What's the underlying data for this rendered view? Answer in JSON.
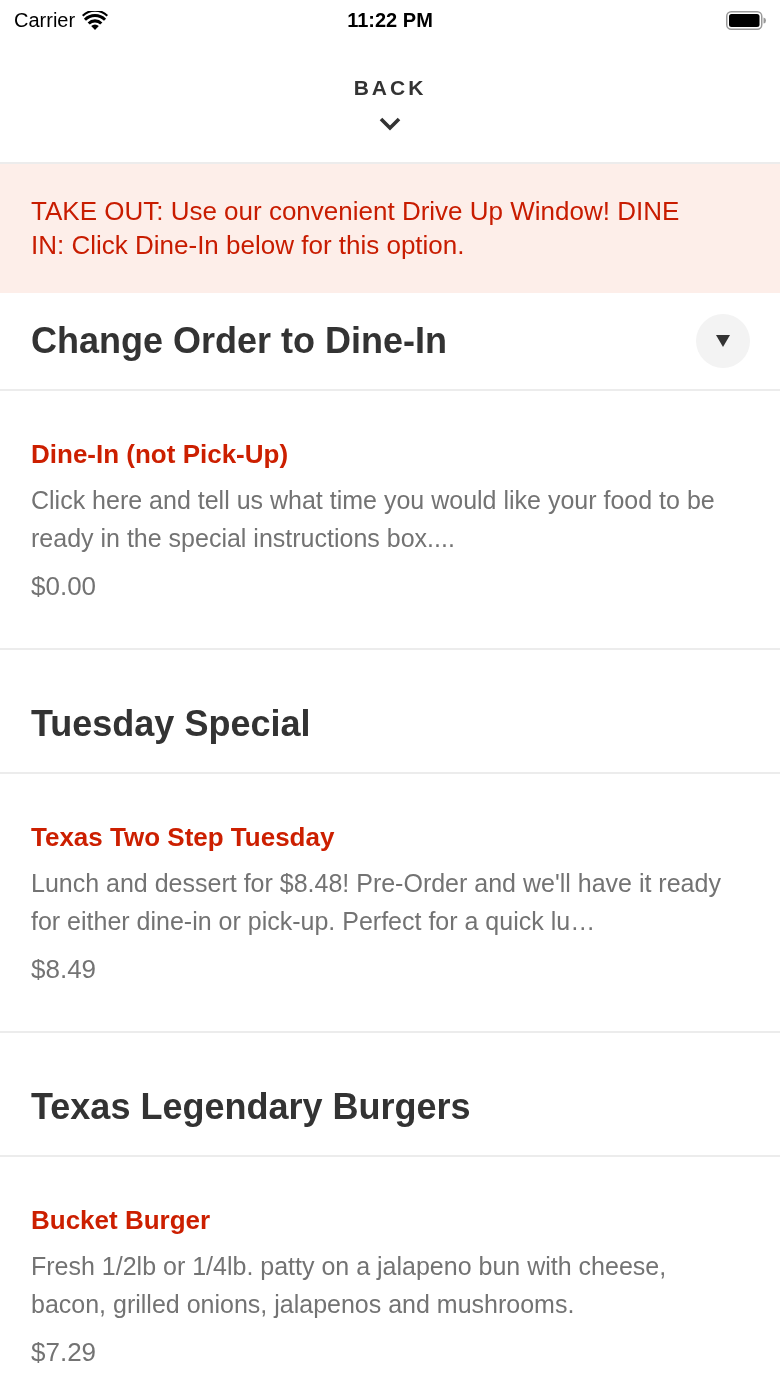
{
  "status_bar": {
    "carrier": "Carrier",
    "time": "11:22 PM"
  },
  "nav": {
    "back_label": "BACK"
  },
  "notice": {
    "text": "TAKE OUT: Use our convenient Drive Up Window! DINE IN: Click Dine-In below for this option."
  },
  "sections": [
    {
      "title": "Change Order to Dine-In",
      "has_dropdown": true,
      "items": [
        {
          "name": "Dine-In (not Pick-Up)",
          "description": "Click here and tell us what time you would like your food to be ready in the special instructions box....",
          "price": "$0.00"
        }
      ]
    },
    {
      "title": "Tuesday Special",
      "has_dropdown": false,
      "items": [
        {
          "name": "Texas Two Step Tuesday",
          "description": "Lunch and dessert for $8.48! Pre-Order and we'll have it ready for either dine-in or pick-up. Perfect for a quick lu…",
          "price": "$8.49"
        }
      ]
    },
    {
      "title": "Texas Legendary Burgers",
      "has_dropdown": false,
      "items": [
        {
          "name": "Bucket Burger",
          "description": "Fresh 1/2lb or 1/4lb. patty on a jalapeno bun with cheese, bacon, grilled onions, jalapenos and mushrooms.",
          "price": "$7.29"
        }
      ]
    }
  ]
}
